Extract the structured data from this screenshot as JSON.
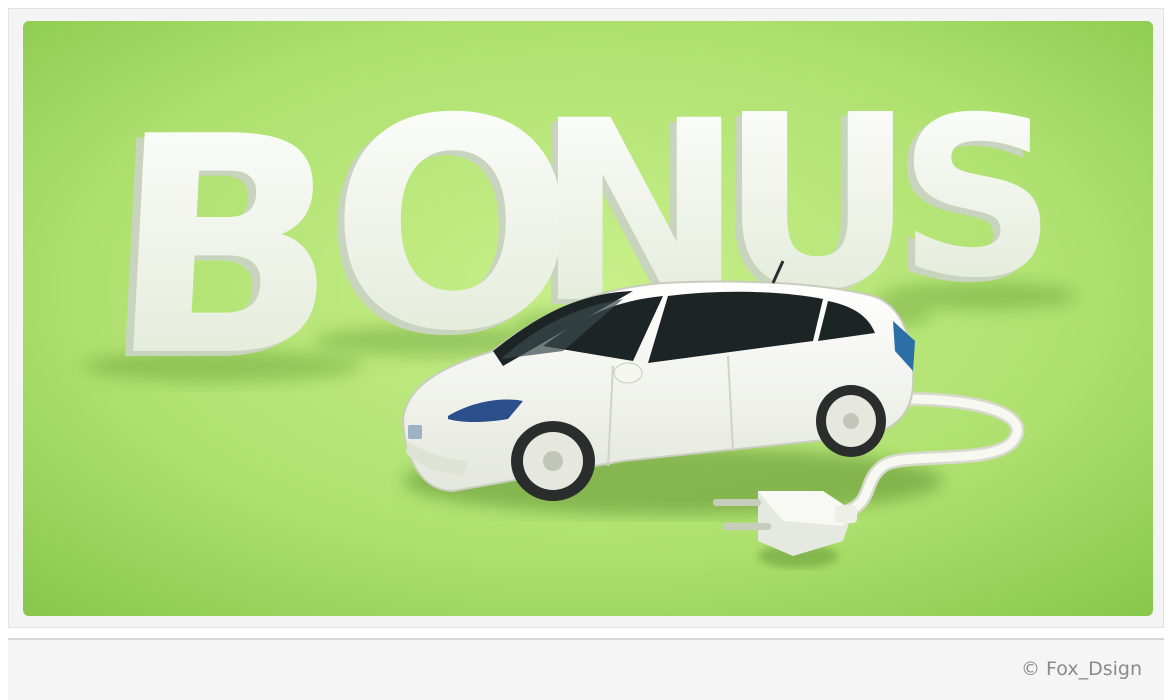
{
  "image": {
    "subject": "hero-photo",
    "palette": {
      "background_light": "#c8f08a",
      "background_dark": "#86c64a",
      "letters": "#eef3e7",
      "letters_shade": "#c9d4be",
      "car_body": "#f4f4ee",
      "window": "#1d2426"
    },
    "letters": "BONUS"
  },
  "credit": {
    "text": "© Fox_Dsign"
  }
}
